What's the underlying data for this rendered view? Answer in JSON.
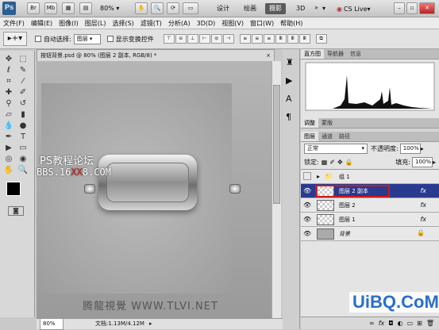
{
  "app": {
    "logo": "Ps",
    "br_label": "Br",
    "mb_label": "Mb",
    "zoom": "80%"
  },
  "workspaces": [
    "设计",
    "绘画",
    "摄影",
    "3D"
  ],
  "workspace_active": 2,
  "cslive": "CS Live",
  "menus": [
    "文件(F)",
    "编辑(E)",
    "图像(I)",
    "图层(L)",
    "选择(S)",
    "滤镜(T)",
    "分析(A)",
    "3D(D)",
    "视图(V)",
    "窗口(W)",
    "帮助(H)"
  ],
  "options": {
    "auto_select": "自动选择:",
    "auto_select_value": "图层",
    "show_transform": "显示变换控件"
  },
  "document": {
    "tab_title": "按钮背景.psd @ 80% (图层 2 副本, RGB/8) *",
    "zoom": "80%",
    "doc_info": "文档:1.13M/4.12M"
  },
  "watermarks": {
    "forum1": "PS教程论坛",
    "forum2": "BBS.16XX8.COM",
    "site": "腾龍視覺 WWW.TLVI.NET",
    "uibq": "UiBQ.CoM"
  },
  "histogram": {
    "tabs": [
      "直方图",
      "导航器",
      "信息"
    ]
  },
  "adjust_tabs": [
    "调整",
    "蒙版"
  ],
  "layers": {
    "tabs": [
      "图层",
      "通道",
      "路径"
    ],
    "blend_mode": "正常",
    "opacity_label": "不透明度:",
    "opacity": "100%",
    "lock_label": "锁定:",
    "fill_label": "填充:",
    "fill": "100%",
    "items": [
      {
        "name": "组 1",
        "fx": ""
      },
      {
        "name": "图层 2 副本",
        "fx": "fx"
      },
      {
        "name": "图层 2",
        "fx": "fx"
      },
      {
        "name": "图层 1",
        "fx": "fx"
      },
      {
        "name": "背景",
        "fx": ""
      }
    ]
  },
  "colors": {
    "accent_blue": "#2a3a8e",
    "selected_outline": "#d01818",
    "watermark_red": "#d01818"
  }
}
